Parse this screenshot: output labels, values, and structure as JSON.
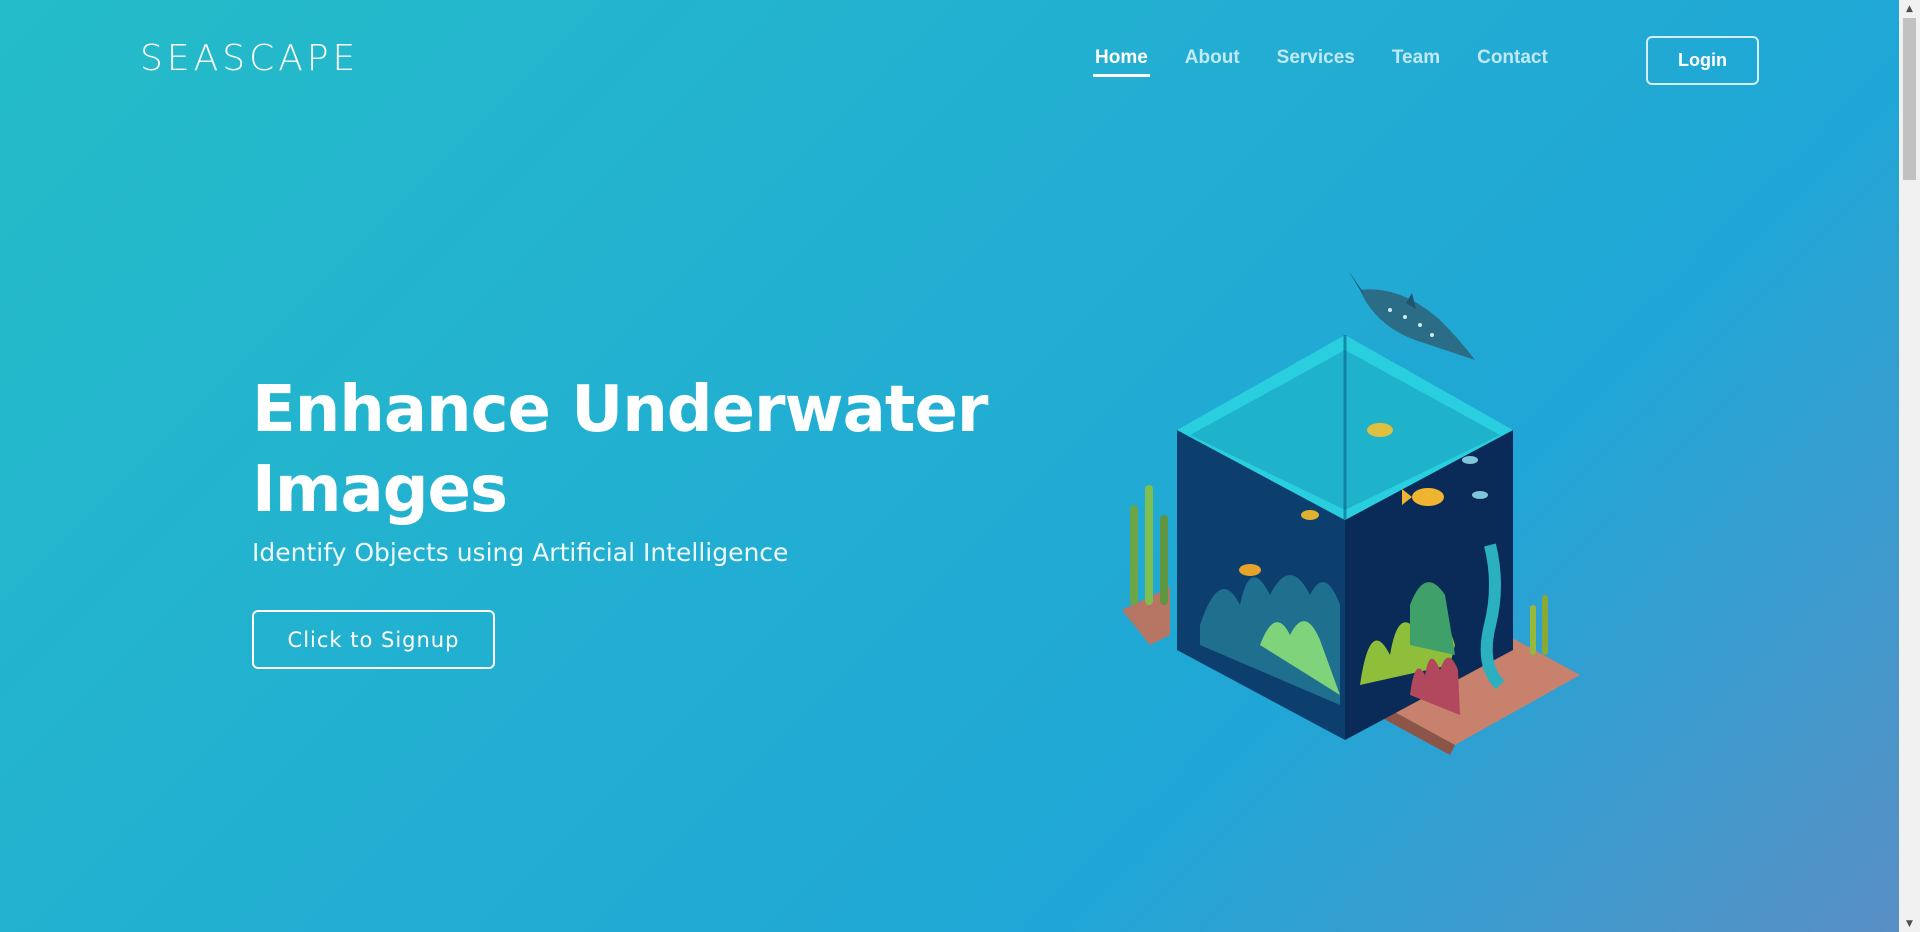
{
  "navbar": {
    "brand": "SEASCAPE",
    "links": [
      {
        "label": "Home",
        "active": true
      },
      {
        "label": "About"
      },
      {
        "label": "Services"
      },
      {
        "label": "Team"
      },
      {
        "label": "Contact"
      }
    ],
    "login_label": "Login"
  },
  "hero": {
    "title_line1": "Enhance Underwater",
    "title_line2": "Images",
    "subtitle": "Identify Objects using Artificial Intelligence",
    "cta_label": "Click to Signup",
    "illustration": "isometric-aquarium-cube-illustration"
  },
  "colors": {
    "background_start": "#24bcc8",
    "background_end": "#5a8ec4",
    "text": "#ffffff"
  }
}
